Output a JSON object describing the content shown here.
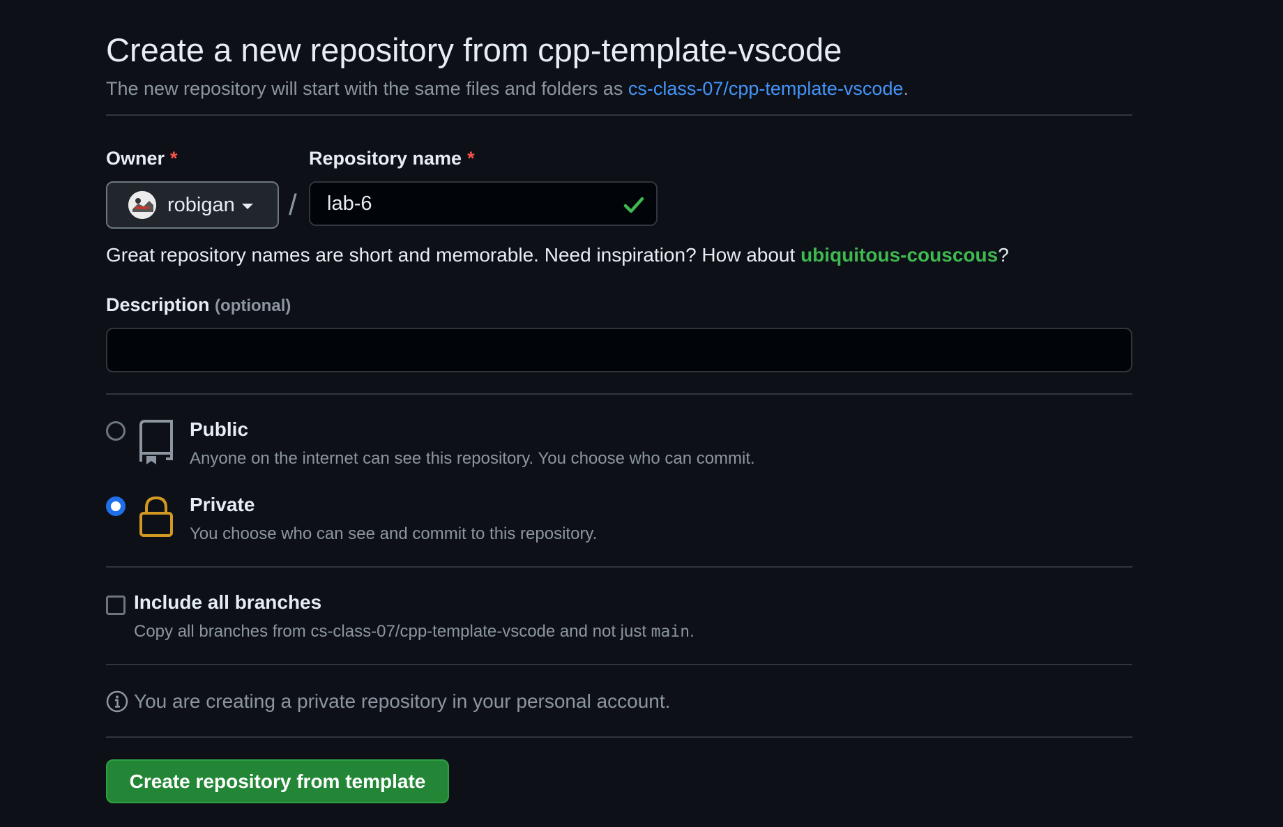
{
  "header": {
    "title": "Create a new repository from cpp-template-vscode",
    "subtitle_prefix": "The new repository will start with the same files and folders as ",
    "template_link": "cs-class-07/cpp-template-vscode",
    "subtitle_suffix": "."
  },
  "owner": {
    "label": "Owner",
    "required_mark": "*",
    "value": "robigan"
  },
  "repo_name": {
    "label": "Repository name",
    "required_mark": "*",
    "separator": "/",
    "value": "lab-6",
    "valid_icon": "check-icon"
  },
  "name_hint": {
    "text_prefix": "Great repository names are short and memorable. Need inspiration? How about ",
    "suggestion": "ubiquitous-couscous",
    "text_suffix": "?"
  },
  "description": {
    "label": "Description",
    "optional": "(optional)",
    "value": ""
  },
  "visibility": {
    "selected": "Private",
    "options": [
      {
        "title": "Public",
        "desc": "Anyone on the internet can see this repository. You choose who can commit.",
        "icon": "repo-icon"
      },
      {
        "title": "Private",
        "desc": "You choose who can see and commit to this repository.",
        "icon": "lock-icon"
      }
    ]
  },
  "branches": {
    "checked": false,
    "label": "Include all branches",
    "desc_prefix": "Copy all branches from cs-class-07/cpp-template-vscode and not just ",
    "desc_code": "main",
    "desc_suffix": "."
  },
  "info": {
    "icon": "info-icon",
    "text": "You are creating a private repository in your personal account."
  },
  "submit": {
    "label": "Create repository from template"
  },
  "colors": {
    "background": "#0d1117",
    "link": "#4493f8",
    "success": "#3fb950",
    "button": "#238636",
    "lock": "#d29922",
    "required": "#f85149"
  }
}
